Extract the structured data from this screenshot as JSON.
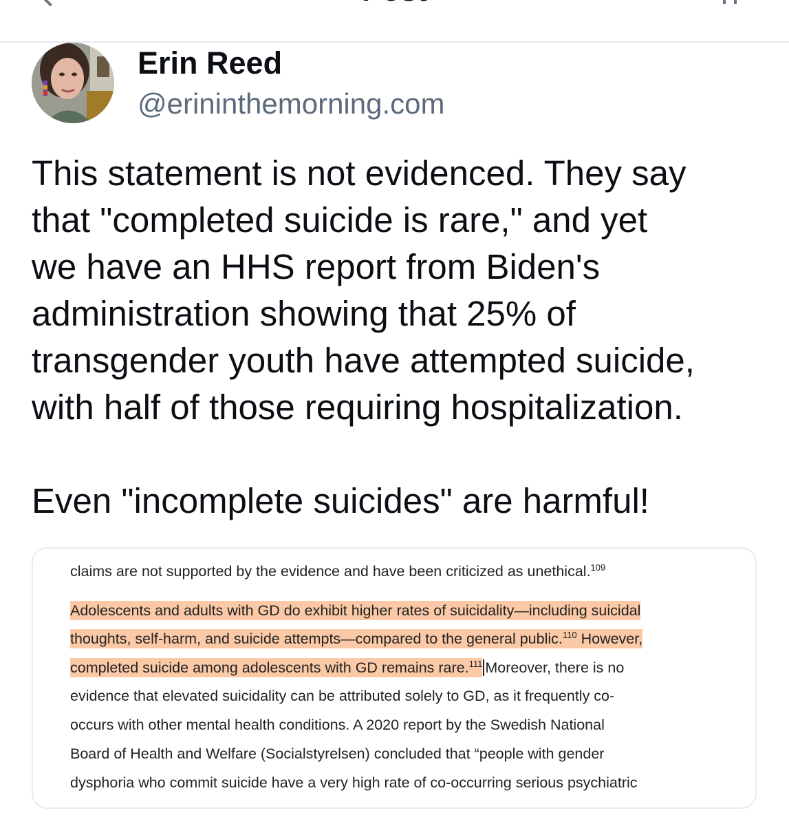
{
  "header": {
    "title": "Post"
  },
  "author": {
    "name": "Erin Reed",
    "handle": "@erininthemorning.com"
  },
  "post": {
    "lines": [
      "This statement is not evidenced. They say",
      "that \"completed suicide is rare,\" and yet",
      "we have an HHS report from Biden's",
      "administration showing that 25% of",
      "transgender youth have attempted suicide,",
      "with half of those requiring hospitalization."
    ],
    "closing": "Even \"incomplete suicides\" are harmful!"
  },
  "embed": {
    "line1": "claims are not supported by the evidence and have been criticized as unethical.",
    "ref1": "109",
    "line2": "Adolescents and adults with GD do exhibit higher rates of suicidality—including suicidal",
    "line3": "thoughts, self-harm, and suicide attempts—compared to the general public.",
    "ref2": "110",
    "line3b": "However,",
    "line4": "completed suicide among adolescents with GD remains rare.",
    "ref3": "111",
    "line4b": "Moreover, there is no",
    "line5": "evidence that elevated suicidality can be attributed solely to GD, as it frequently co-",
    "line6": "occurs with other mental health conditions. A 2020 report by the Swedish National",
    "line7": "Board of Health and Welfare (Socialstyrelsen) concluded that “people with gender",
    "line8": "dysphoria who commit suicide have a very high rate of co-occurring serious psychiatric"
  },
  "colors": {
    "highlight": "#fbc9a6",
    "handle": "#5b6b7c",
    "text": "#0b0f14"
  }
}
